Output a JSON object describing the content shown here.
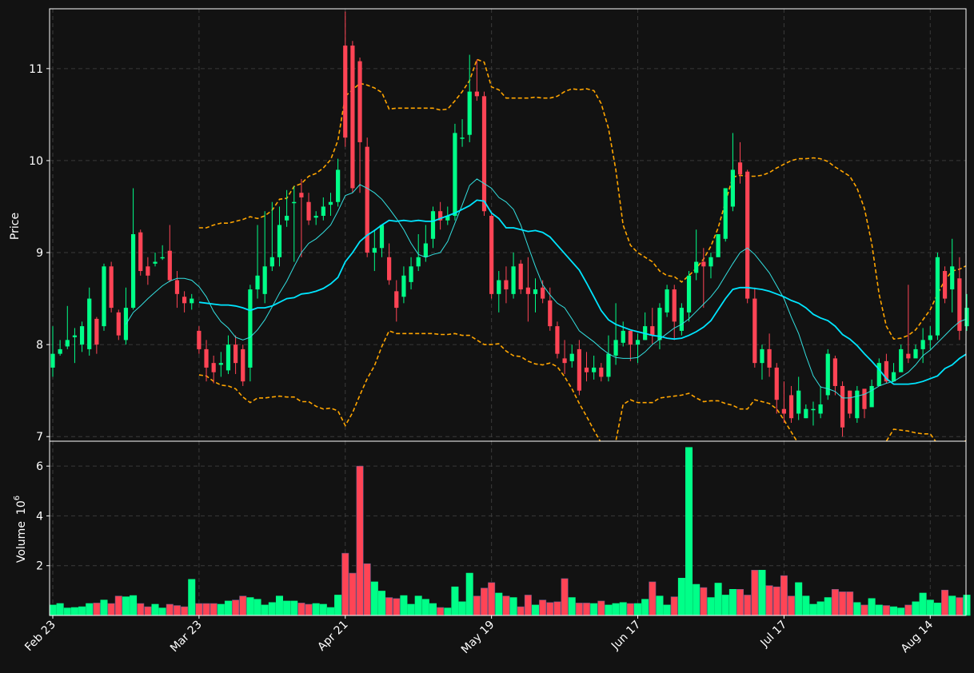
{
  "chart_data": [
    {
      "type": "candlestick",
      "ylabel": "Price",
      "ylim": [
        6.95,
        11.65
      ],
      "yticks": [
        "7",
        "8",
        "9",
        "10",
        "11"
      ],
      "grid": true,
      "xticks": [
        "Feb 23",
        "Mar 23",
        "Apr 21",
        "May 19",
        "Jun 17",
        "Jul 17",
        "Aug 14"
      ],
      "xtick_index": [
        0,
        20,
        40,
        60,
        80,
        100,
        120
      ],
      "colors": {
        "up": "#00ff88",
        "down": "#ff4455",
        "ma_fast": "#33e0e0",
        "ma_slow": "#00e5ff",
        "bands": "#ffa500",
        "background": "#121212",
        "grid": "#3a3a3a"
      },
      "close": [
        7.9,
        7.95,
        8.05,
        8.1,
        8.2,
        8.5,
        8.0,
        8.85,
        8.4,
        8.1,
        8.4,
        9.2,
        8.8,
        8.75,
        8.9,
        8.95,
        8.7,
        8.55,
        8.45,
        8.5,
        7.95,
        7.75,
        7.7,
        7.8,
        8.0,
        7.8,
        7.6,
        8.6,
        8.75,
        8.85,
        8.95,
        9.3,
        9.4,
        9.55,
        9.6,
        9.35,
        9.4,
        9.5,
        9.55,
        9.9,
        10.25,
        9.7,
        10.2,
        9.0,
        9.05,
        9.3,
        8.7,
        8.4,
        8.75,
        8.85,
        8.95,
        9.1,
        9.45,
        9.35,
        9.4,
        10.3,
        10.25,
        10.75,
        10.7,
        9.45,
        8.55,
        8.7,
        8.6,
        8.85,
        8.6,
        8.55,
        8.6,
        8.5,
        8.2,
        7.9,
        7.8,
        7.9,
        7.5,
        7.7,
        7.75,
        7.65,
        7.9,
        8.05,
        8.15,
        8.0,
        8.05,
        8.2,
        8.1,
        8.4,
        8.6,
        8.25,
        8.4,
        8.75,
        8.9,
        8.85,
        8.95,
        9.2,
        9.7,
        9.9,
        9.85,
        8.5,
        7.8,
        7.95,
        7.75,
        7.4,
        7.25,
        7.2,
        7.5,
        7.3,
        7.3,
        7.35,
        7.9,
        7.55,
        7.1,
        7.25,
        7.5,
        7.3,
        7.55,
        7.8,
        7.6,
        7.7,
        7.95,
        7.85,
        7.95,
        8.05,
        8.1,
        8.95,
        8.5,
        8.85,
        8.15,
        8.4
      ],
      "open": [
        7.75,
        7.9,
        7.98,
        8.08,
        8.0,
        7.95,
        8.28,
        8.2,
        8.85,
        8.35,
        8.05,
        8.4,
        9.22,
        8.85,
        8.88,
        8.95,
        9.02,
        8.7,
        8.52,
        8.45,
        8.15,
        7.95,
        7.8,
        7.78,
        7.72,
        8.0,
        7.95,
        7.75,
        8.6,
        8.55,
        8.85,
        8.95,
        9.35,
        9.55,
        9.65,
        9.55,
        9.38,
        9.4,
        9.52,
        9.55,
        11.25,
        11.25,
        11.08,
        10.15,
        9.0,
        9.05,
        8.95,
        8.58,
        8.52,
        8.68,
        8.85,
        8.95,
        9.15,
        9.45,
        9.35,
        9.4,
        10.25,
        10.28,
        10.75,
        10.7,
        9.4,
        8.55,
        8.7,
        8.55,
        8.88,
        8.62,
        8.55,
        8.62,
        8.48,
        8.2,
        7.85,
        7.82,
        7.95,
        7.75,
        7.7,
        7.75,
        7.65,
        7.88,
        8.02,
        8.15,
        8.0,
        8.05,
        8.2,
        8.05,
        8.35,
        8.6,
        8.15,
        8.35,
        8.78,
        8.9,
        8.85,
        8.95,
        9.15,
        9.5,
        9.98,
        9.88,
        8.5,
        7.8,
        7.95,
        7.75,
        7.3,
        7.45,
        7.25,
        7.2,
        7.3,
        7.25,
        7.45,
        7.85,
        7.55,
        7.5,
        7.2,
        7.52,
        7.32,
        7.55,
        7.82,
        7.6,
        7.7,
        7.9,
        7.85,
        7.95,
        8.05,
        8.1,
        8.8,
        8.6,
        8.72,
        8.2
      ],
      "high": [
        8.2,
        8.05,
        8.42,
        8.18,
        8.25,
        8.62,
        8.3,
        8.88,
        8.9,
        8.38,
        8.62,
        9.7,
        9.25,
        8.95,
        9.0,
        9.08,
        9.3,
        8.8,
        8.58,
        8.55,
        8.2,
        8.05,
        7.88,
        7.92,
        8.1,
        8.1,
        8.0,
        8.65,
        9.3,
        9.45,
        9.55,
        9.5,
        9.68,
        9.72,
        9.8,
        9.65,
        9.45,
        9.6,
        9.65,
        10.02,
        11.62,
        11.3,
        11.12,
        10.25,
        9.25,
        9.3,
        9.1,
        8.7,
        8.85,
        8.95,
        9.2,
        9.3,
        9.5,
        9.55,
        9.5,
        10.4,
        10.45,
        11.15,
        11.1,
        10.75,
        9.42,
        8.8,
        8.85,
        9.0,
        8.92,
        8.95,
        8.72,
        8.7,
        8.62,
        8.25,
        8.05,
        8.0,
        8.05,
        7.92,
        7.88,
        7.8,
        8.1,
        8.45,
        8.25,
        8.15,
        8.12,
        8.35,
        8.4,
        8.45,
        8.65,
        8.65,
        8.45,
        8.8,
        9.25,
        9.05,
        9.0,
        9.2,
        9.7,
        10.3,
        10.2,
        9.9,
        8.62,
        8.0,
        8.12,
        7.8,
        7.6,
        7.55,
        7.65,
        7.35,
        7.38,
        7.55,
        7.95,
        7.88,
        7.6,
        7.5,
        7.55,
        7.45,
        7.62,
        7.85,
        7.9,
        7.8,
        8.0,
        8.65,
        8.0,
        8.18,
        8.2,
        9.0,
        8.85,
        9.15,
        8.95,
        8.55
      ],
      "low": [
        7.65,
        7.88,
        7.95,
        7.8,
        7.92,
        7.88,
        7.9,
        8.15,
        8.35,
        8.05,
        8.0,
        8.38,
        8.75,
        8.65,
        8.85,
        8.92,
        8.68,
        8.4,
        8.35,
        8.38,
        7.9,
        7.6,
        7.58,
        7.65,
        7.68,
        7.68,
        7.55,
        7.6,
        8.5,
        8.45,
        8.8,
        8.85,
        9.28,
        8.9,
        8.95,
        9.3,
        9.3,
        9.35,
        9.4,
        9.5,
        10.15,
        9.65,
        9.65,
        8.95,
        8.8,
        8.95,
        8.65,
        8.25,
        8.45,
        8.6,
        8.8,
        8.9,
        9.05,
        9.25,
        9.3,
        9.35,
        10.15,
        10.2,
        10.65,
        9.4,
        8.5,
        8.35,
        8.45,
        8.5,
        8.55,
        8.25,
        8.35,
        8.45,
        8.15,
        7.85,
        7.68,
        7.75,
        7.45,
        7.6,
        7.62,
        7.6,
        7.6,
        7.78,
        7.98,
        7.82,
        7.8,
        8.05,
        8.0,
        7.95,
        8.3,
        8.05,
        8.1,
        8.25,
        8.7,
        8.4,
        8.72,
        9.0,
        9.12,
        9.45,
        9.75,
        8.45,
        7.75,
        7.62,
        7.65,
        7.25,
        7.15,
        7.15,
        7.18,
        7.2,
        7.12,
        7.2,
        7.4,
        7.45,
        7.0,
        7.2,
        7.15,
        7.2,
        7.48,
        7.55,
        7.58,
        7.65,
        7.85,
        7.8,
        7.88,
        7.8,
        7.95,
        8.05,
        8.45,
        8.35,
        8.05,
        8.15
      ],
      "ma_fast": [
        null,
        null,
        null,
        null,
        null,
        null,
        null,
        null,
        null,
        null,
        8.22,
        8.35,
        8.42,
        8.5,
        8.57,
        8.64,
        8.69,
        8.72,
        8.72,
        8.7,
        8.63,
        8.52,
        8.36,
        8.25,
        8.18,
        8.08,
        8.05,
        8.08,
        8.16,
        8.27,
        8.41,
        8.56,
        8.69,
        8.85,
        9.0,
        9.1,
        9.15,
        9.22,
        9.3,
        9.45,
        9.62,
        9.65,
        9.74,
        9.7,
        9.65,
        9.58,
        9.48,
        9.37,
        9.25,
        9.1,
        8.98,
        8.95,
        8.98,
        9.0,
        9.12,
        9.32,
        9.52,
        9.73,
        9.8,
        9.75,
        9.7,
        9.6,
        9.55,
        9.47,
        9.3,
        9.07,
        8.85,
        8.65,
        8.54,
        8.45,
        8.4,
        8.28,
        8.15,
        8.09,
        8.03,
        7.96,
        7.9,
        7.86,
        7.85,
        7.85,
        7.86,
        7.92,
        8.0,
        8.06,
        8.12,
        8.18,
        8.22,
        8.28,
        8.36,
        8.44,
        8.52,
        8.62,
        8.75,
        8.88,
        9.0,
        9.05,
        8.98,
        8.88,
        8.78,
        8.64,
        8.5,
        8.3,
        8.12,
        7.88,
        7.66,
        7.54,
        7.52,
        7.49,
        7.42,
        7.42,
        7.44,
        7.46,
        7.5,
        7.55,
        7.58,
        7.6,
        7.65,
        7.7,
        7.78,
        7.88,
        7.94,
        8.02,
        8.1,
        8.18,
        8.25,
        8.28
      ],
      "ma_slow": [
        null,
        null,
        null,
        null,
        null,
        null,
        null,
        null,
        null,
        null,
        null,
        null,
        null,
        null,
        null,
        null,
        null,
        null,
        null,
        null,
        8.46,
        8.45,
        8.44,
        8.43,
        8.43,
        8.42,
        8.4,
        8.37,
        8.4,
        8.4,
        8.42,
        8.46,
        8.5,
        8.51,
        8.55,
        8.56,
        8.58,
        8.61,
        8.66,
        8.73,
        8.9,
        9.0,
        9.12,
        9.19,
        9.24,
        9.3,
        9.35,
        9.34,
        9.35,
        9.34,
        9.35,
        9.34,
        9.34,
        9.37,
        9.4,
        9.43,
        9.47,
        9.51,
        9.57,
        9.56,
        9.43,
        9.37,
        9.27,
        9.27,
        9.25,
        9.23,
        9.24,
        9.22,
        9.17,
        9.08,
        8.99,
        8.9,
        8.81,
        8.67,
        8.52,
        8.37,
        8.27,
        8.22,
        8.19,
        8.16,
        8.14,
        8.12,
        8.1,
        8.09,
        8.07,
        8.06,
        8.07,
        8.1,
        8.14,
        8.19,
        8.26,
        8.38,
        8.5,
        8.6,
        8.62,
        8.62,
        8.61,
        8.6,
        8.58,
        8.55,
        8.52,
        8.48,
        8.45,
        8.4,
        8.33,
        8.29,
        8.26,
        8.2,
        8.11,
        8.06,
        7.99,
        7.9,
        7.82,
        7.73,
        7.63,
        7.57,
        7.57,
        7.57,
        7.58,
        7.6,
        7.63,
        7.66,
        7.74,
        7.78,
        7.85,
        7.9,
        7.96
      ],
      "band_upper": [
        null,
        null,
        null,
        null,
        null,
        null,
        null,
        null,
        null,
        null,
        null,
        null,
        null,
        null,
        null,
        null,
        null,
        null,
        null,
        null,
        9.27,
        9.27,
        9.3,
        9.32,
        9.32,
        9.34,
        9.36,
        9.39,
        9.37,
        9.4,
        9.46,
        9.58,
        9.59,
        9.72,
        9.75,
        9.83,
        9.86,
        9.92,
        10.01,
        10.22,
        10.7,
        10.77,
        10.84,
        10.82,
        10.79,
        10.74,
        10.56,
        10.57,
        10.57,
        10.57,
        10.57,
        10.57,
        10.57,
        10.55,
        10.56,
        10.65,
        10.75,
        10.87,
        11.1,
        11.07,
        10.8,
        10.77,
        10.68,
        10.68,
        10.68,
        10.68,
        10.69,
        10.68,
        10.68,
        10.7,
        10.75,
        10.78,
        10.77,
        10.78,
        10.76,
        10.62,
        10.35,
        9.9,
        9.3,
        9.08,
        9.0,
        8.95,
        8.9,
        8.8,
        8.75,
        8.74,
        8.68,
        8.75,
        8.83,
        8.93,
        9.07,
        9.27,
        9.55,
        9.82,
        9.84,
        9.83,
        9.83,
        9.84,
        9.87,
        9.92,
        9.96,
        10.0,
        10.02,
        10.02,
        10.03,
        10.02,
        9.99,
        9.93,
        9.88,
        9.83,
        9.7,
        9.48,
        9.1,
        8.55,
        8.2,
        8.06,
        8.07,
        8.1,
        8.16,
        8.27,
        8.38,
        8.55,
        8.7,
        8.8,
        8.82,
        8.86,
        8.89
      ],
      "band_lower": [
        null,
        null,
        null,
        null,
        null,
        null,
        null,
        null,
        null,
        null,
        null,
        null,
        null,
        null,
        null,
        null,
        null,
        null,
        null,
        null,
        7.67,
        7.66,
        7.6,
        7.56,
        7.55,
        7.52,
        7.43,
        7.37,
        7.42,
        7.42,
        7.43,
        7.44,
        7.43,
        7.43,
        7.38,
        7.38,
        7.33,
        7.3,
        7.31,
        7.28,
        7.12,
        7.26,
        7.45,
        7.63,
        7.77,
        7.98,
        8.15,
        8.12,
        8.12,
        8.12,
        8.12,
        8.12,
        8.12,
        8.11,
        8.11,
        8.12,
        8.1,
        8.1,
        8.05,
        8.0,
        8.0,
        8.01,
        7.93,
        7.88,
        7.87,
        7.82,
        7.79,
        7.78,
        7.8,
        7.76,
        7.65,
        7.52,
        7.36,
        7.22,
        7.07,
        6.93,
        6.82,
        6.95,
        7.35,
        7.4,
        7.37,
        7.37,
        7.37,
        7.42,
        7.43,
        7.44,
        7.45,
        7.47,
        7.42,
        7.38,
        7.39,
        7.39,
        7.36,
        7.34,
        7.3,
        7.3,
        7.4,
        7.38,
        7.36,
        7.3,
        7.18,
        7.05,
        6.92,
        6.82,
        6.76,
        6.72,
        6.73,
        6.78,
        6.82,
        6.85,
        6.82,
        6.8,
        6.78,
        6.82,
        6.95,
        7.08,
        7.07,
        7.06,
        7.04,
        7.03,
        7.03,
        6.92,
        6.85,
        6.82,
        6.92,
        6.96,
        7.02
      ]
    },
    {
      "type": "bar",
      "ylabel": "Volume",
      "ylabel_unit": "10",
      "ylabel_exp": "6",
      "ylim": [
        0,
        7.0
      ],
      "yticks": [
        "2",
        "4",
        "6"
      ],
      "volume": [
        0.42,
        0.48,
        0.3,
        0.32,
        0.35,
        0.48,
        0.5,
        0.62,
        0.48,
        0.78,
        0.75,
        0.8,
        0.48,
        0.35,
        0.45,
        0.3,
        0.45,
        0.4,
        0.35,
        1.45,
        0.48,
        0.48,
        0.48,
        0.45,
        0.58,
        0.62,
        0.78,
        0.72,
        0.65,
        0.42,
        0.52,
        0.78,
        0.58,
        0.58,
        0.5,
        0.45,
        0.48,
        0.45,
        0.32,
        0.82,
        2.5,
        1.7,
        6.0,
        2.08,
        1.35,
        0.98,
        0.72,
        0.68,
        0.8,
        0.45,
        0.78,
        0.65,
        0.48,
        0.32,
        0.3,
        1.15,
        0.55,
        1.7,
        0.78,
        1.1,
        1.32,
        0.9,
        0.78,
        0.72,
        0.35,
        0.82,
        0.42,
        0.62,
        0.52,
        0.55,
        1.48,
        0.72,
        0.5,
        0.5,
        0.48,
        0.58,
        0.42,
        0.48,
        0.52,
        0.48,
        0.48,
        0.65,
        1.35,
        0.78,
        0.42,
        0.75,
        1.5,
        6.75,
        1.25,
        1.12,
        0.72,
        1.3,
        0.82,
        1.05,
        1.05,
        0.82,
        1.82,
        1.82,
        1.2,
        1.15,
        1.6,
        0.78,
        1.32,
        0.78,
        0.45,
        0.55,
        0.72,
        1.05,
        0.95,
        0.95,
        0.52,
        0.42,
        0.68,
        0.42,
        0.4,
        0.35,
        0.3,
        0.42,
        0.55,
        0.9,
        0.62,
        0.5,
        1.02,
        0.78,
        0.72,
        0.82,
        0.55
      ]
    }
  ]
}
